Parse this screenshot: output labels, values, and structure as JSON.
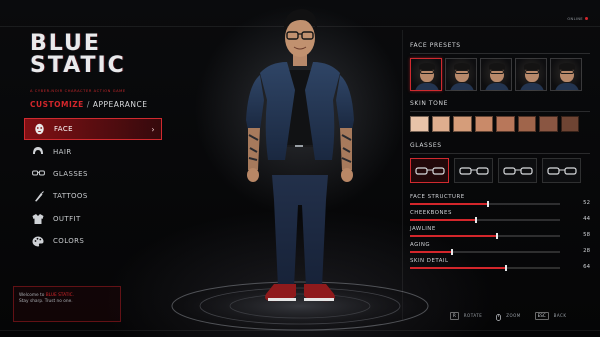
{
  "header": {
    "tags": [
      "",
      "",
      "",
      "",
      ""
    ],
    "subtag": "",
    "side_label_top": "",
    "side_label_mid": ""
  },
  "logo": {
    "line1": "BLUE",
    "line2": "STATIC",
    "tagline": "A CYBER-NOIR CHARACTER ACTION GAME"
  },
  "breadcrumb": {
    "section": "CUSTOMIZE",
    "separator": "/",
    "page": "APPEARANCE"
  },
  "menu": {
    "items": [
      {
        "label": "FACE",
        "icon": "face-mask-icon",
        "active": true
      },
      {
        "label": "HAIR",
        "icon": "hair-icon",
        "active": false
      },
      {
        "label": "GLASSES",
        "icon": "glasses-icon",
        "active": false
      },
      {
        "label": "TATTOOS",
        "icon": "tattoo-icon",
        "active": false
      },
      {
        "label": "OUTFIT",
        "icon": "jacket-icon",
        "active": false
      },
      {
        "label": "COLORS",
        "icon": "palette-icon",
        "active": false
      }
    ],
    "chevron": "›"
  },
  "log": {
    "header": "",
    "line1_prefix": "Welcome to",
    "line1_highlight": "BLUE STATIC.",
    "line2": "Stay sharp. Trust no one."
  },
  "status": {
    "line1": "",
    "line2": "ONLINE"
  },
  "panel": {
    "face_presets": {
      "title": "FACE PRESETS",
      "count": 5,
      "selected_index": 0
    },
    "skin_tone": {
      "title": "SKIN TONE",
      "swatches": [
        "#e8c3a8",
        "#dfae8e",
        "#d59d7a",
        "#c98a69",
        "#b8775a",
        "#a0654b",
        "#8a5642",
        "#6e4433"
      ],
      "selected_index": -1
    },
    "glasses": {
      "title": "GLASSES",
      "selected_index": 0,
      "count": 4
    },
    "sliders": [
      {
        "label": "FACE STRUCTURE",
        "value": "52",
        "level": 0.52
      },
      {
        "label": "CHEEKBONES",
        "value": "44",
        "level": 0.44
      },
      {
        "label": "JAWLINE",
        "value": "58",
        "level": 0.58
      },
      {
        "label": "AGING",
        "value": "28",
        "level": 0.28
      },
      {
        "label": "SKIN DETAIL",
        "value": "64",
        "level": 0.64
      }
    ]
  },
  "hints": {
    "rotate_key": "R",
    "rotate_label": "ROTATE",
    "zoom_label": "ZOOM",
    "back_key": "ESC",
    "back_label": "BACK"
  },
  "colors": {
    "accent": "#d3262b",
    "background": "#050506",
    "text": "#cfd2d6"
  }
}
